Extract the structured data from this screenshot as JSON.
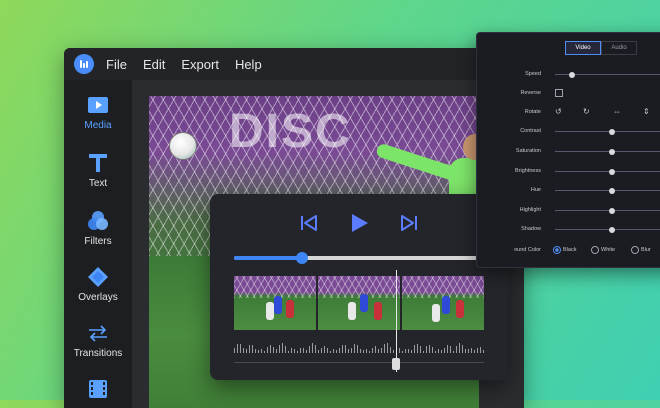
{
  "menubar": {
    "items": [
      "File",
      "Edit",
      "Export",
      "Help"
    ]
  },
  "sidebar": {
    "items": [
      {
        "label": "Media",
        "icon": "media-icon",
        "active": true
      },
      {
        "label": "Text",
        "icon": "text-icon",
        "active": false
      },
      {
        "label": "Filters",
        "icon": "filters-icon",
        "active": false
      },
      {
        "label": "Overlays",
        "icon": "overlays-icon",
        "active": false
      },
      {
        "label": "Transitions",
        "icon": "transitions-icon",
        "active": false
      },
      {
        "label": "",
        "icon": "film-icon",
        "active": false
      }
    ]
  },
  "preview": {
    "banner_text": "DISC"
  },
  "player": {
    "progress": 0.27,
    "playhead_fraction": 0.65
  },
  "properties": {
    "tabs": [
      "Video",
      "Audio"
    ],
    "active_tab": "Video",
    "rows": {
      "speed": {
        "label": "Speed",
        "value": 0.15
      },
      "reverse": {
        "label": "Reverse",
        "checked": false
      },
      "rotate": {
        "label": "Rotate"
      },
      "contrast": {
        "label": "Contrast",
        "value": 0.52
      },
      "saturation": {
        "label": "Saturation",
        "value": 0.52
      },
      "brightness": {
        "label": "Brightness",
        "value": 0.52
      },
      "hue": {
        "label": "Hue",
        "value": 0.52
      },
      "highlight": {
        "label": "Highlight",
        "value": 0.52
      },
      "shadow": {
        "label": "Shadow",
        "value": 0.52
      },
      "background_color": {
        "label": "ound Color",
        "options": [
          "Black",
          "White",
          "Blur"
        ],
        "selected": "Black"
      }
    }
  },
  "colors": {
    "accent": "#3e86f5",
    "keeper_jersey": "#7de46a"
  }
}
